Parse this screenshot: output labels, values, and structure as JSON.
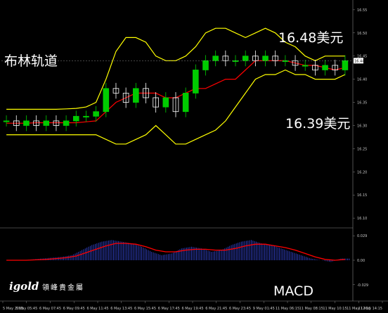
{
  "labels": {
    "indicator_title": "布林轨道",
    "upper_price": "16.48美元",
    "lower_price": "16.39美元",
    "macd_label": "MACD",
    "logo_text": "igold",
    "logo_chinese": "領峰貴金屬"
  },
  "colors": {
    "background": "#000000",
    "bollinger_band": "#ffff00",
    "moving_average": "#ff0000",
    "bull_candle": "#00cc00",
    "bear_candle": "#ffffff",
    "macd_histogram": "#3344cc",
    "macd_signal": "#ff0000",
    "price_tag": "#ffffff",
    "grid_line": "#888888"
  },
  "chart_data": [
    {
      "type": "candlestick",
      "title": "布林轨道",
      "y_ticks": [
        "16.55",
        "16.50",
        "16.45",
        "16.40",
        "16.35",
        "16.30",
        "16.25",
        "16.20",
        "16.15",
        "16.10"
      ],
      "ylim": [
        16.085,
        16.565
      ],
      "current_price": "16.44",
      "x_labels": [
        "5 May 2015",
        "5 May 05:45",
        "6 May 07:45",
        "6 May 09:45",
        "6 May 11:45",
        "6 May 13:45",
        "6 May 15:45",
        "6 May 17:45",
        "6 May 19:45",
        "6 May 21:45",
        "6 May 23:45",
        "9 May 01:45",
        "11 May 06:15",
        "11 May 08:15",
        "11 May 10:15",
        "11 May 12:15",
        "11 May 14:15"
      ],
      "annotations": [
        {
          "text": "16.48美元",
          "value": 16.48
        },
        {
          "text": "16.39美元",
          "value": 16.39
        }
      ],
      "series": [
        {
          "name": "upper_band",
          "values": [
            16.335,
            16.335,
            16.335,
            16.335,
            16.335,
            16.335,
            16.336,
            16.337,
            16.34,
            16.35,
            16.4,
            16.46,
            16.49,
            16.49,
            16.48,
            16.45,
            16.44,
            16.44,
            16.45,
            16.47,
            16.5,
            16.51,
            16.51,
            16.5,
            16.49,
            16.5,
            16.51,
            16.5,
            16.48,
            16.47,
            16.45,
            16.44,
            16.45,
            16.45,
            16.45
          ]
        },
        {
          "name": "middle_band",
          "values": [
            16.305,
            16.305,
            16.305,
            16.306,
            16.306,
            16.306,
            16.306,
            16.306,
            16.308,
            16.31,
            16.33,
            16.35,
            16.36,
            16.37,
            16.37,
            16.37,
            16.36,
            16.36,
            16.37,
            16.38,
            16.38,
            16.39,
            16.4,
            16.4,
            16.42,
            16.44,
            16.44,
            16.44,
            16.44,
            16.435,
            16.43,
            16.43,
            16.425,
            16.42,
            16.425
          ]
        },
        {
          "name": "lower_band",
          "values": [
            16.28,
            16.28,
            16.28,
            16.28,
            16.28,
            16.28,
            16.28,
            16.28,
            16.28,
            16.28,
            16.27,
            16.26,
            16.26,
            16.27,
            16.28,
            16.3,
            16.28,
            16.26,
            16.26,
            16.27,
            16.28,
            16.29,
            16.31,
            16.34,
            16.37,
            16.4,
            16.41,
            16.41,
            16.42,
            16.41,
            16.41,
            16.4,
            16.4,
            16.4,
            16.41
          ]
        },
        {
          "name": "close",
          "values": [
            16.31,
            16.3,
            16.31,
            16.3,
            16.31,
            16.3,
            16.31,
            16.32,
            16.32,
            16.33,
            16.38,
            16.37,
            16.35,
            16.38,
            16.36,
            16.34,
            16.36,
            16.33,
            16.37,
            16.42,
            16.44,
            16.45,
            16.44,
            16.44,
            16.45,
            16.44,
            16.45,
            16.44,
            16.44,
            16.43,
            16.43,
            16.42,
            16.43,
            16.42,
            16.44
          ]
        }
      ]
    },
    {
      "type": "bar",
      "title": "MACD",
      "y_ticks": [
        "0.029",
        "0.00",
        "-0.029"
      ],
      "ylim": [
        -0.045,
        0.035
      ],
      "series": [
        {
          "name": "histogram",
          "values": [
            0.0,
            0.0,
            0.0,
            0.001,
            0.002,
            0.003,
            0.004,
            0.006,
            0.012,
            0.018,
            0.022,
            0.024,
            0.022,
            0.02,
            0.016,
            0.01,
            0.006,
            0.008,
            0.014,
            0.016,
            0.014,
            0.01,
            0.012,
            0.018,
            0.022,
            0.024,
            0.02,
            0.018,
            0.014,
            0.01,
            0.006,
            0.002,
            0.0,
            -0.002,
            0.002
          ]
        },
        {
          "name": "signal",
          "values": [
            0.0,
            0.0,
            0.0,
            0.0005,
            0.001,
            0.002,
            0.003,
            0.005,
            0.009,
            0.013,
            0.017,
            0.02,
            0.02,
            0.019,
            0.016,
            0.012,
            0.01,
            0.01,
            0.012,
            0.013,
            0.013,
            0.012,
            0.012,
            0.014,
            0.017,
            0.019,
            0.019,
            0.017,
            0.015,
            0.012,
            0.008,
            0.004,
            0.001,
            0.0,
            0.001
          ]
        }
      ]
    }
  ]
}
